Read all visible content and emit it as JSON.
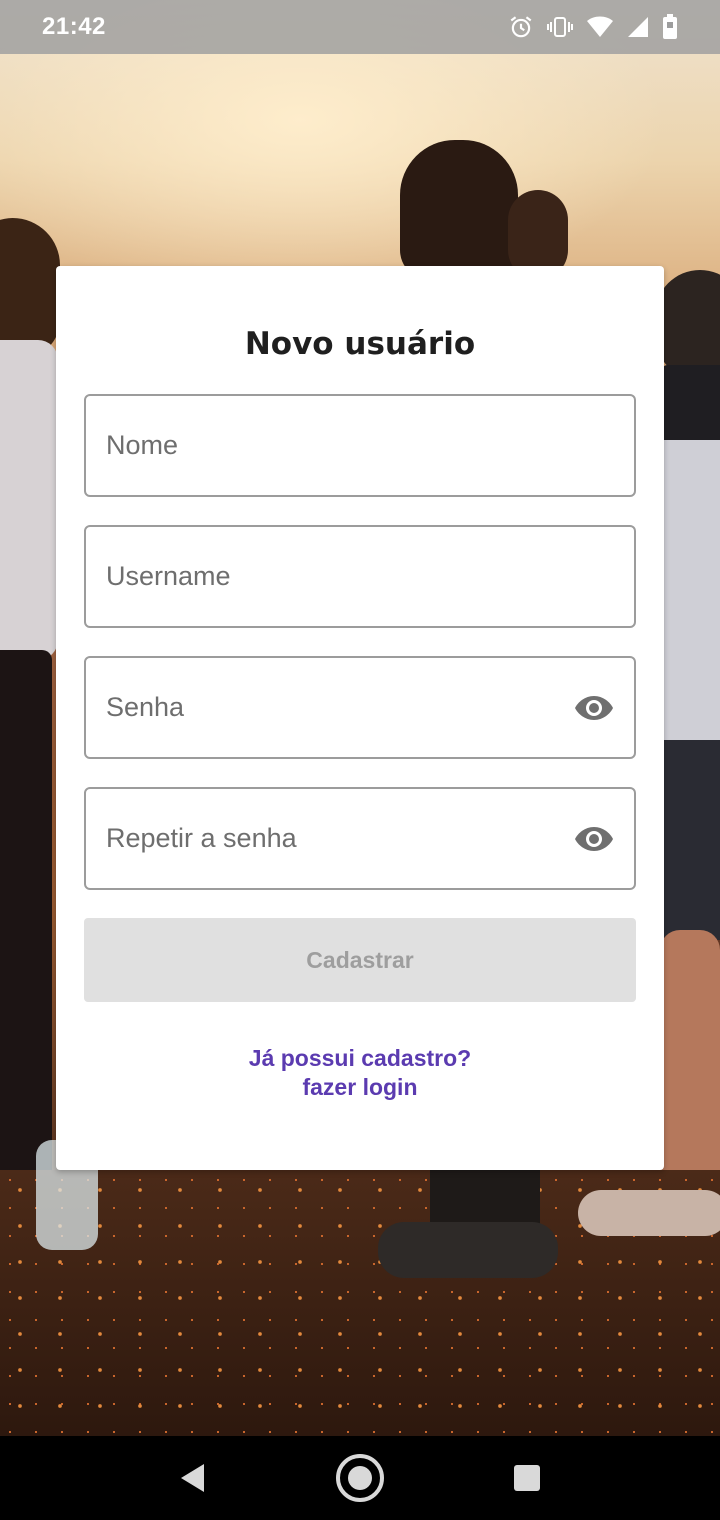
{
  "status_bar": {
    "time": "21:42",
    "icons": [
      "alarm-icon",
      "vibrate-icon",
      "wifi-icon",
      "signal-icon",
      "battery-icon"
    ]
  },
  "form": {
    "title": "Novo usuário",
    "fields": [
      {
        "placeholder": "Nome",
        "value": ""
      },
      {
        "placeholder": "Username",
        "value": ""
      },
      {
        "placeholder": "Senha",
        "value": "",
        "icon": "eye-icon"
      },
      {
        "placeholder": "Repetir a senha",
        "value": "",
        "icon": "eye-icon"
      }
    ],
    "submit_label": "Cadastrar",
    "login_prompt": "Já possui cadastro?",
    "login_link": "fazer login"
  },
  "nav_bar": {
    "icons": [
      "back-icon",
      "home-icon",
      "recents-icon"
    ]
  },
  "colors": {
    "link": "#5b3bb0",
    "button_disabled_bg": "#e0e0e0",
    "button_disabled_text": "#9e9e9e",
    "field_border": "#9c9c9c"
  }
}
